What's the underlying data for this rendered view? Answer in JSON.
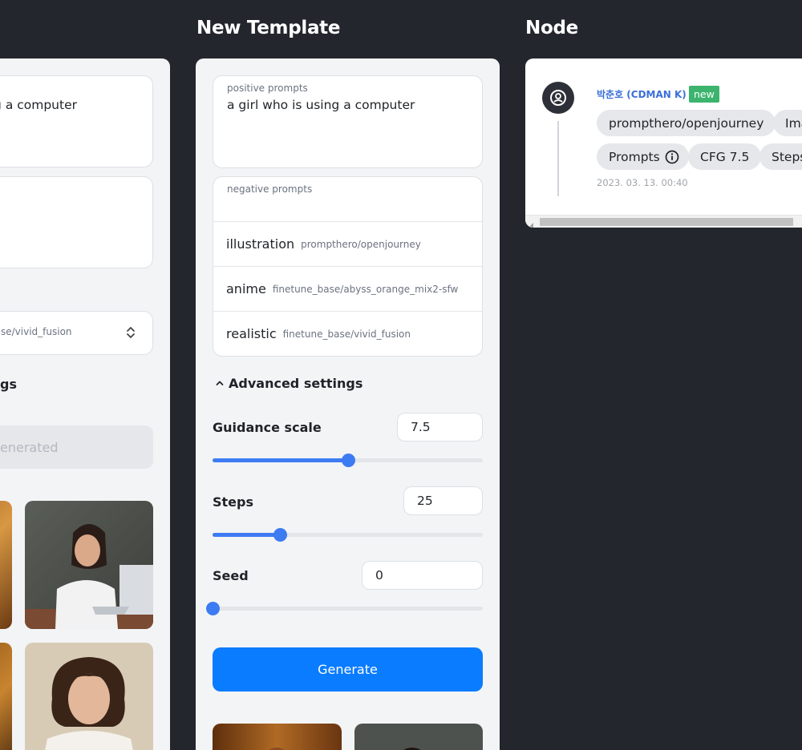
{
  "columns": {
    "template_title": "New Template",
    "node_title": "Node"
  },
  "left_panel": {
    "prompt_fragment": "g a computer",
    "model_fragment": "se/vivid_fusion",
    "settings_fragment": "gs",
    "button_fragment": "enerated"
  },
  "template": {
    "positive_label": "positive prompts",
    "positive_value": "a girl who is using a computer",
    "negative_label": "negative prompts",
    "options": [
      {
        "name": "illustration",
        "model": "prompthero/openjourney"
      },
      {
        "name": "anime",
        "model": "finetune_base/abyss_orange_mix2-sfw"
      },
      {
        "name": "realistic",
        "model": "finetune_base/vivid_fusion"
      }
    ],
    "advanced_label": "Advanced settings",
    "guidance": {
      "label": "Guidance scale",
      "value": "7.5",
      "fraction": 0.5
    },
    "steps": {
      "label": "Steps",
      "value": "25",
      "fraction": 0.25
    },
    "seed": {
      "label": "Seed",
      "value": "0",
      "fraction": 0.0
    },
    "generate_label": "Generate"
  },
  "node": {
    "author": "박춘호 (CDMAN K)",
    "badge": "new",
    "chips_row1": [
      "prompthero/openjourney",
      "Ima"
    ],
    "chips_row2": [
      "Prompts",
      "CFG 7.5",
      "Steps"
    ],
    "timestamp": "2023. 03. 13. 00:40"
  },
  "colors": {
    "background": "#24262d",
    "accent": "#3d7bf2",
    "generate": "#0a7cff",
    "badge_new": "#3cb46e",
    "author": "#3b6fd9"
  },
  "icons": [
    "chevron-updown-icon",
    "caret-up-icon",
    "user-circle-icon",
    "info-circle-icon",
    "arrow-left-icon"
  ]
}
